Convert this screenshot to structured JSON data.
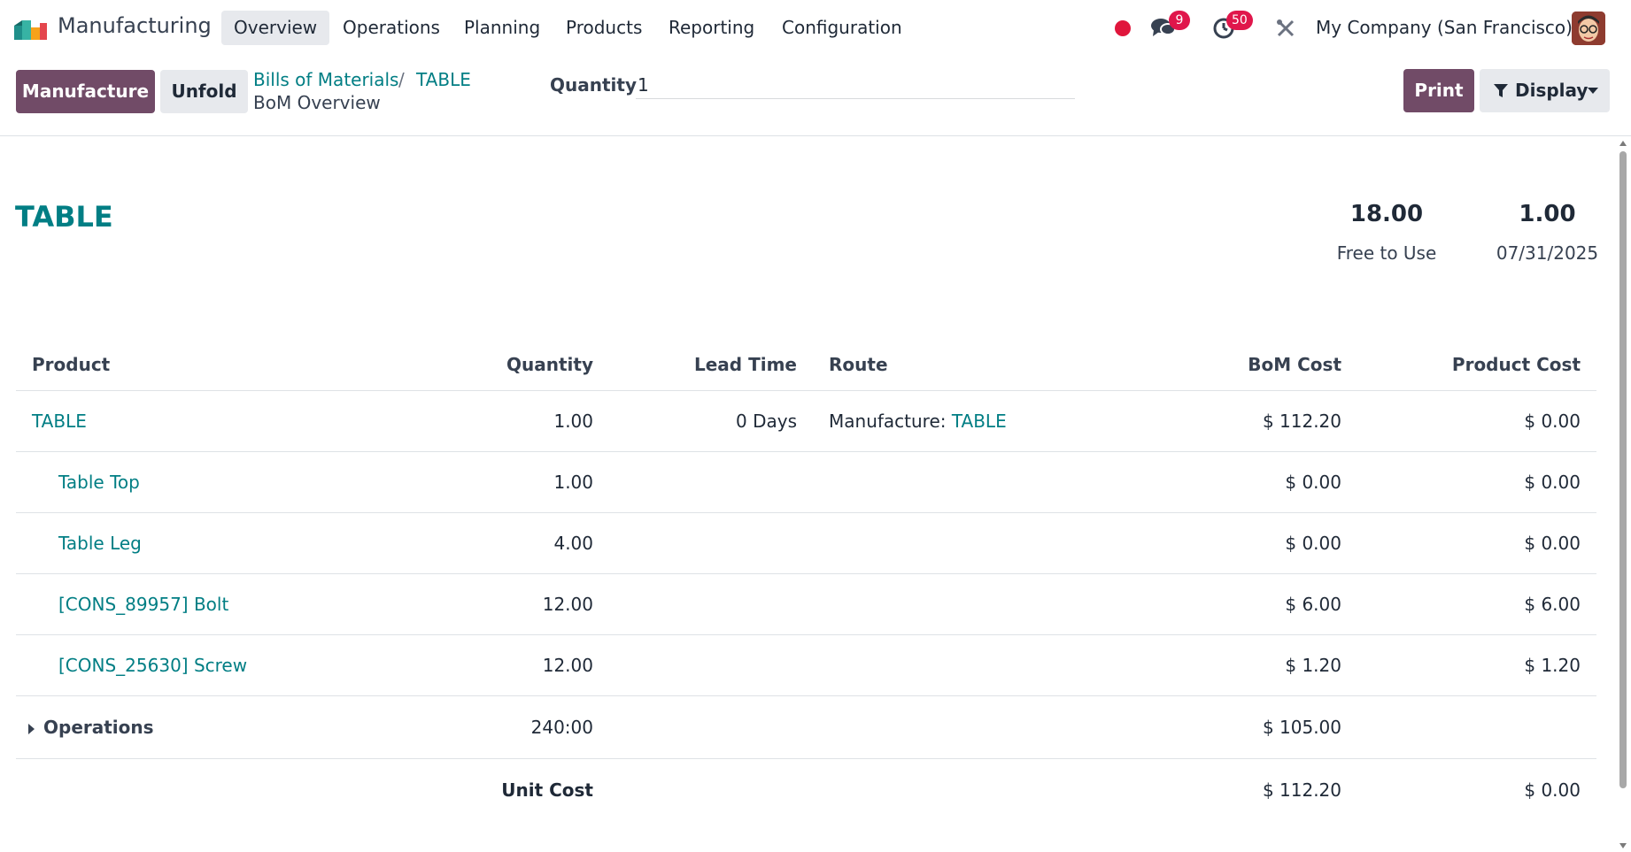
{
  "navbar": {
    "app_name": "Manufacturing",
    "menu": [
      "Overview",
      "Operations",
      "Planning",
      "Products",
      "Reporting",
      "Configuration"
    ],
    "messages_count": "9",
    "activities_count": "50",
    "company": "My Company (San Francisco)"
  },
  "control_panel": {
    "manufacture_label": "Manufacture",
    "unfold_label": "Unfold",
    "breadcrumb_parent": "Bills of Materials",
    "breadcrumb_separator": "/",
    "breadcrumb_record": "TABLE",
    "breadcrumb_current": "BoM Overview",
    "quantity_label": "Quantity",
    "quantity_value": "1",
    "print_label": "Print",
    "display_label": "Display"
  },
  "report": {
    "product_name": "TABLE",
    "stats": [
      {
        "value": "18.00",
        "label": "Free to Use"
      },
      {
        "value": "1.00",
        "label": "07/31/2025"
      }
    ],
    "columns": {
      "product": "Product",
      "quantity": "Quantity",
      "lead_time": "Lead Time",
      "route": "Route",
      "bom_cost": "BoM Cost",
      "product_cost": "Product Cost"
    },
    "main_row": {
      "product": "TABLE",
      "quantity": "1.00",
      "lead_time": "0 Days",
      "route_prefix": "Manufacture: ",
      "route_link": "TABLE",
      "bom_cost": "$ 112.20",
      "product_cost": "$ 0.00"
    },
    "components": [
      {
        "product": "Table Top",
        "quantity": "1.00",
        "bom_cost": "$ 0.00",
        "product_cost": "$ 0.00"
      },
      {
        "product": "Table Leg",
        "quantity": "4.00",
        "bom_cost": "$ 0.00",
        "product_cost": "$ 0.00"
      },
      {
        "product": "[CONS_89957] Bolt",
        "quantity": "12.00",
        "bom_cost": "$ 6.00",
        "product_cost": "$ 6.00"
      },
      {
        "product": "[CONS_25630] Screw",
        "quantity": "12.00",
        "bom_cost": "$ 1.20",
        "product_cost": "$ 1.20"
      }
    ],
    "operations": {
      "label": "Operations",
      "quantity": "240:00",
      "bom_cost": "$ 105.00"
    },
    "unit_cost": {
      "label": "Unit Cost",
      "bom_cost": "$ 112.20",
      "product_cost": "$ 0.00"
    }
  },
  "colors": {
    "brand": "#714b67",
    "link": "#017e84",
    "badge": "#e0164b",
    "record_dot": "#e0163c"
  },
  "icons": [
    "app-logo",
    "chat-icon",
    "clock-icon",
    "tools-icon",
    "filter-icon",
    "caret-down-icon",
    "caret-right-icon"
  ]
}
